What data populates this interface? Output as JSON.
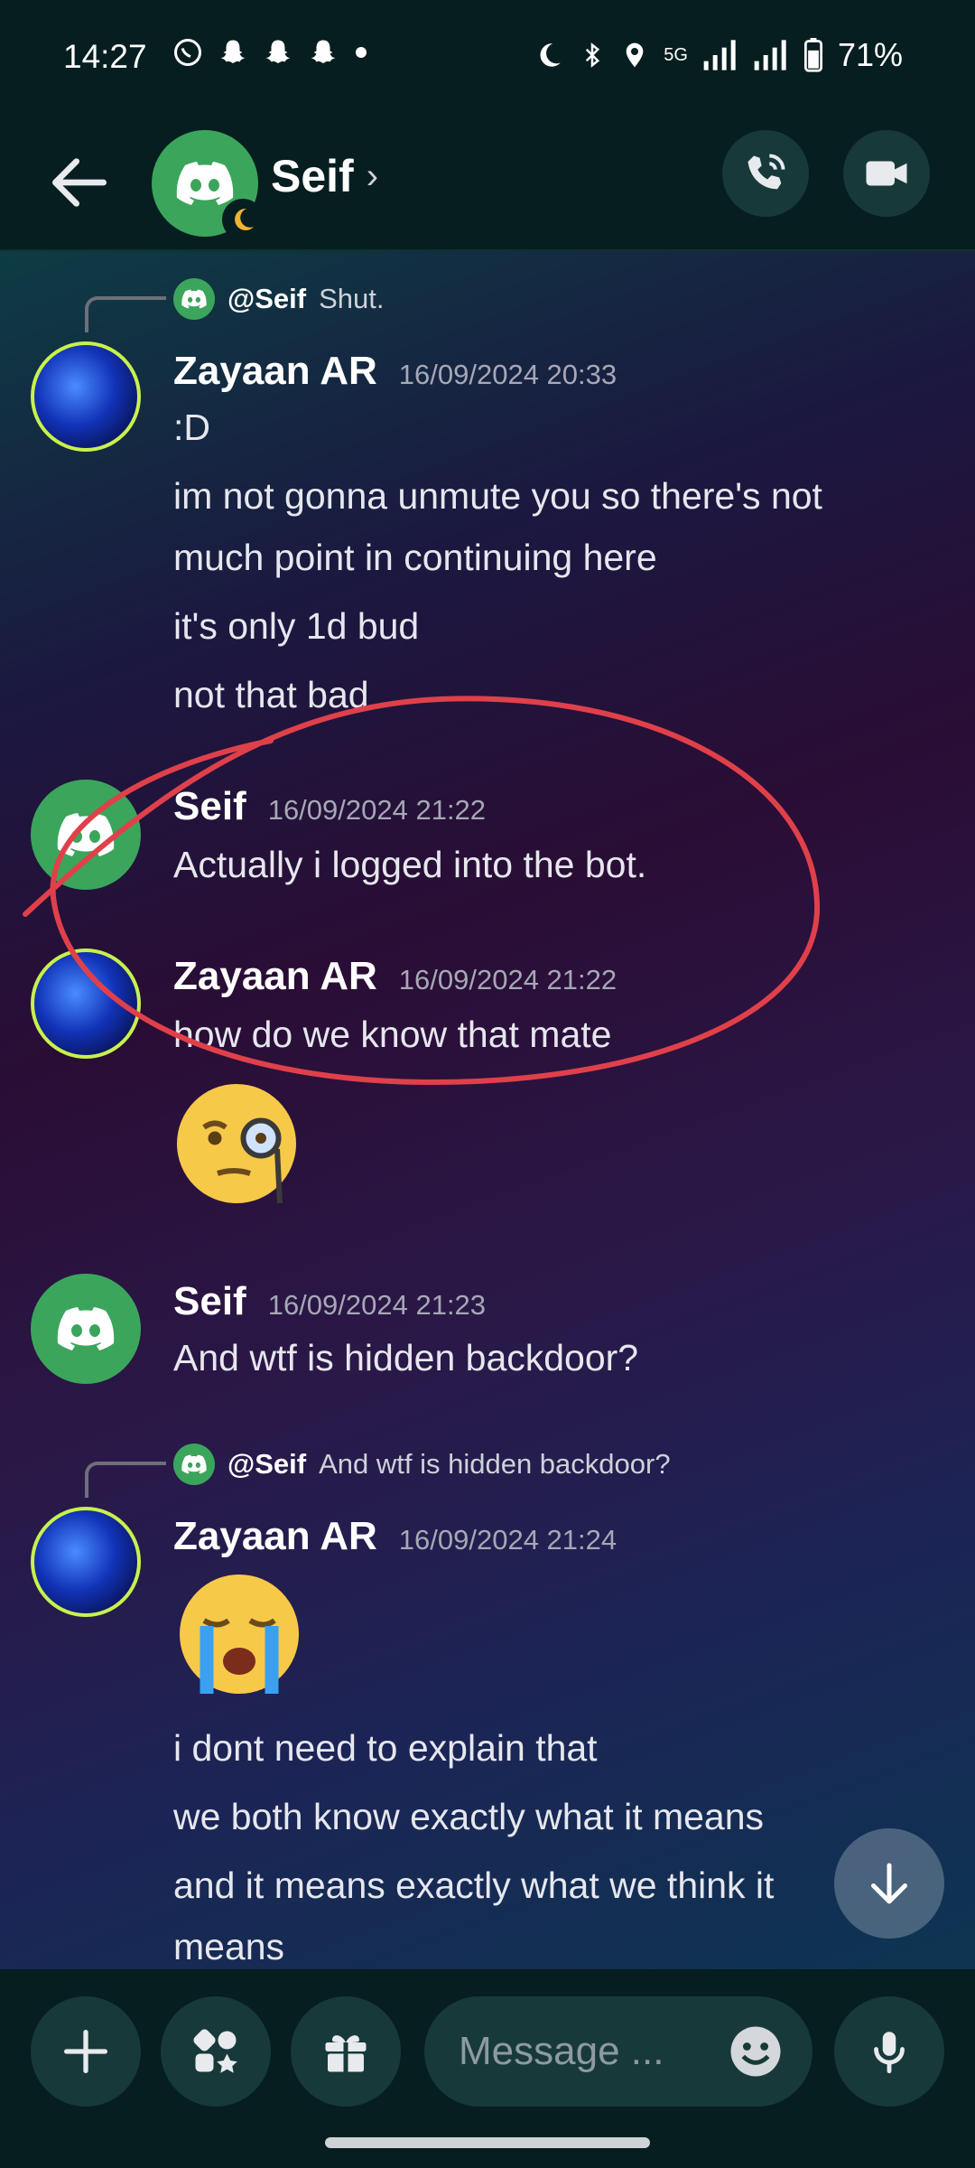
{
  "status_bar": {
    "time": "14:27",
    "battery": "71%",
    "network": "5G",
    "left_icons": [
      "whatsapp-icon",
      "snapchat-icon",
      "snapchat-icon",
      "snapchat-icon",
      "dot-icon"
    ],
    "right_icons": [
      "moon-icon",
      "bluetooth-icon",
      "location-icon",
      "signal-icon",
      "signal-icon",
      "battery-icon"
    ]
  },
  "header": {
    "title": "Seif",
    "chevron": "›",
    "back_icon": "arrow-left-icon",
    "call_icon": "phone-icon",
    "video_icon": "video-icon"
  },
  "messages": {
    "reply1": {
      "mention": "@Seif",
      "text": "Shut."
    },
    "m1": {
      "author": "Zayaan AR",
      "time": "16/09/2024 20:33",
      "lines": [
        ":D",
        "im not gonna unmute you so there's not",
        "much point in continuing here",
        "it's only 1d bud",
        "not that bad"
      ]
    },
    "m2": {
      "author": "Seif",
      "time": "16/09/2024 21:22",
      "lines": [
        "Actually i logged into the bot."
      ]
    },
    "m3": {
      "author": "Zayaan AR",
      "time": "16/09/2024 21:22",
      "lines": [
        "how do we know that mate"
      ],
      "emoji": "monocle-face-emoji"
    },
    "m4": {
      "author": "Seif",
      "time": "16/09/2024 21:23",
      "lines": [
        "And wtf is hidden backdoor?"
      ]
    },
    "reply2": {
      "mention": "@Seif",
      "text": "And wtf is hidden backdoor?"
    },
    "m5": {
      "author": "Zayaan AR",
      "time": "16/09/2024 21:24",
      "emoji": "loudly-crying-face-emoji",
      "lines": [
        "i dont need to explain that",
        "we both know exactly what it means",
        "and it means exactly what we think it",
        "means"
      ]
    }
  },
  "composer": {
    "placeholder": "Message ...",
    "buttons": [
      "plus-icon",
      "apps-icon",
      "gift-icon",
      "emoji-icon",
      "microphone-icon"
    ]
  },
  "colors": {
    "accent_green": "#3ba55c",
    "annotation_red": "#e0404a",
    "background": "#061e1f"
  }
}
